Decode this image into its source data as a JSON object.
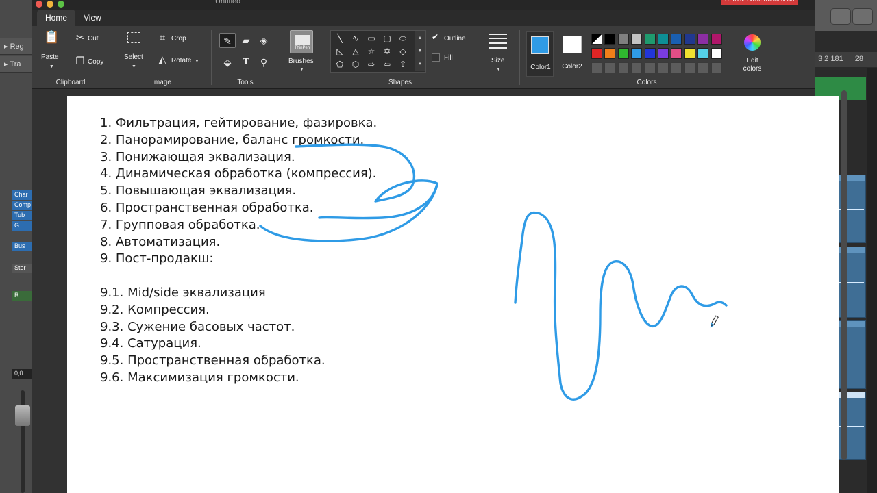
{
  "window": {
    "title": "Untitled",
    "watermark": "Remove Watermark & Ad"
  },
  "tabs": [
    {
      "label": "Home",
      "active": true
    },
    {
      "label": "View",
      "active": false
    }
  ],
  "ribbon": {
    "clipboard": {
      "group_label": "Clipboard",
      "paste": "Paste",
      "cut": "Cut",
      "copy": "Copy"
    },
    "image": {
      "group_label": "Image",
      "select": "Select",
      "crop": "Crop",
      "rotate": "Rotate"
    },
    "tools": {
      "group_label": "Tools"
    },
    "brushes": {
      "label": "Brushes",
      "current": "ThinPen"
    },
    "shapes": {
      "group_label": "Shapes",
      "outline": "Outline",
      "fill": "Fill"
    },
    "size": {
      "label": "Size"
    },
    "colors": {
      "group_label": "Colors",
      "color1_label": "Color1",
      "color2_label": "Color2",
      "edit_colors_line1": "Edit",
      "edit_colors_line2": "colors",
      "color1": "#2f9be6",
      "color2": "#ffffff",
      "palette_row1": [
        "#ffffff",
        "#000000",
        "#7f7f7f",
        "#c3c3c3",
        "#1f9a6e",
        "#0d8f95",
        "#1a5fb0",
        "#20388f",
        "#8c2ea3",
        "#b0166a"
      ],
      "palette_row2": [
        "#e02525",
        "#f07f1a",
        "#2fb82f",
        "#2f9be6",
        "#2236d8",
        "#7a3ce0",
        "#e24e86",
        "#f0e030",
        "#55d0e8",
        "#ffffff"
      ]
    }
  },
  "canvas": {
    "notes": [
      "1. Фильтрация, гейтирование, фазировка.",
      "2. Панорамирование, баланс громкости.",
      "3. Понижающая эквализация.",
      "4. Динамическая обработка (компрессия).",
      "5. Повышающая эквализация.",
      "6. Пространственная обработка.",
      "7. Групповая обработка.",
      "8. Автоматизация.",
      "9. Пост-продакш:",
      "",
      "9.1. Mid/side эквализация",
      "9.2. Компрессия.",
      "9.3. Сужение басовых частот.",
      "9.4. Сатурация.",
      "9.5. Пространственная обработка.",
      "9.6. Максимизация громкости."
    ],
    "stroke_color": "#2f9be6"
  },
  "daw": {
    "left_rows": [
      "Reg",
      "Tra"
    ],
    "left_chips": [
      "Char",
      "Comp",
      "Tub",
      "G",
      "Bus",
      "Ster",
      "R"
    ],
    "fader_readout": "0,0",
    "ruler_text": "3 2 181",
    "ruler_text2": "28"
  }
}
